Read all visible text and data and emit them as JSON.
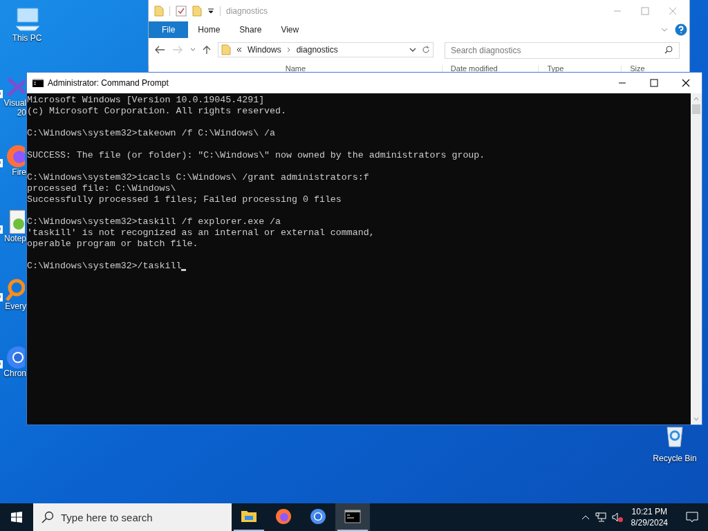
{
  "desktop": {
    "icons": [
      {
        "kind": "pc",
        "lines": [
          "This PC"
        ]
      },
      {
        "kind": "vs",
        "lines": [
          "Visual",
          "20"
        ]
      },
      {
        "kind": "firefox",
        "lines": [
          "Fire"
        ]
      },
      {
        "kind": "notepad",
        "lines": [
          "Notep"
        ]
      },
      {
        "kind": "everything",
        "lines": [
          "Every"
        ]
      },
      {
        "kind": "chrome",
        "lines": [
          "Chron"
        ]
      }
    ],
    "recycle_bin": {
      "label": "Recycle Bin"
    }
  },
  "explorer": {
    "title": "diagnostics",
    "ribbon_tabs": [
      {
        "label": "File",
        "selected": true
      },
      {
        "label": "Home",
        "selected": false
      },
      {
        "label": "Share",
        "selected": false
      },
      {
        "label": "View",
        "selected": false
      }
    ],
    "breadcrumb": [
      "Windows",
      "diagnostics"
    ],
    "search": {
      "placeholder": "Search diagnostics"
    },
    "columns": [
      "Name",
      "Date modified",
      "Type",
      "Size"
    ]
  },
  "console": {
    "title": "Administrator: Command Prompt",
    "blocks": [
      [
        "Microsoft Windows [Version 10.0.19045.4291]",
        "(c) Microsoft Corporation. All rights reserved."
      ],
      [
        "C:\\Windows\\system32>takeown /f C:\\Windows\\ /a"
      ],
      [
        "SUCCESS: The file (or folder): \"C:\\Windows\\\" now owned by the administrators group."
      ],
      [
        "C:\\Windows\\system32>icacls C:\\Windows\\ /grant administrators:f",
        "processed file: C:\\Windows\\",
        "Successfully processed 1 files; Failed processing 0 files"
      ],
      [
        "C:\\Windows\\system32>taskill /f explorer.exe /a",
        "'taskill' is not recognized as an internal or external command,",
        "operable program or batch file."
      ],
      [
        "C:\\Windows\\system32>/taskill"
      ]
    ]
  },
  "taskbar": {
    "search": {
      "placeholder": "Type here to search"
    },
    "apps": [
      {
        "kind": "folder",
        "running": true,
        "selected": false
      },
      {
        "kind": "firefox",
        "running": false,
        "selected": false
      },
      {
        "kind": "chrome",
        "running": false,
        "selected": false
      },
      {
        "kind": "console",
        "running": true,
        "selected": true
      }
    ],
    "time": "10:21 PM",
    "date": "8/29/2024"
  }
}
